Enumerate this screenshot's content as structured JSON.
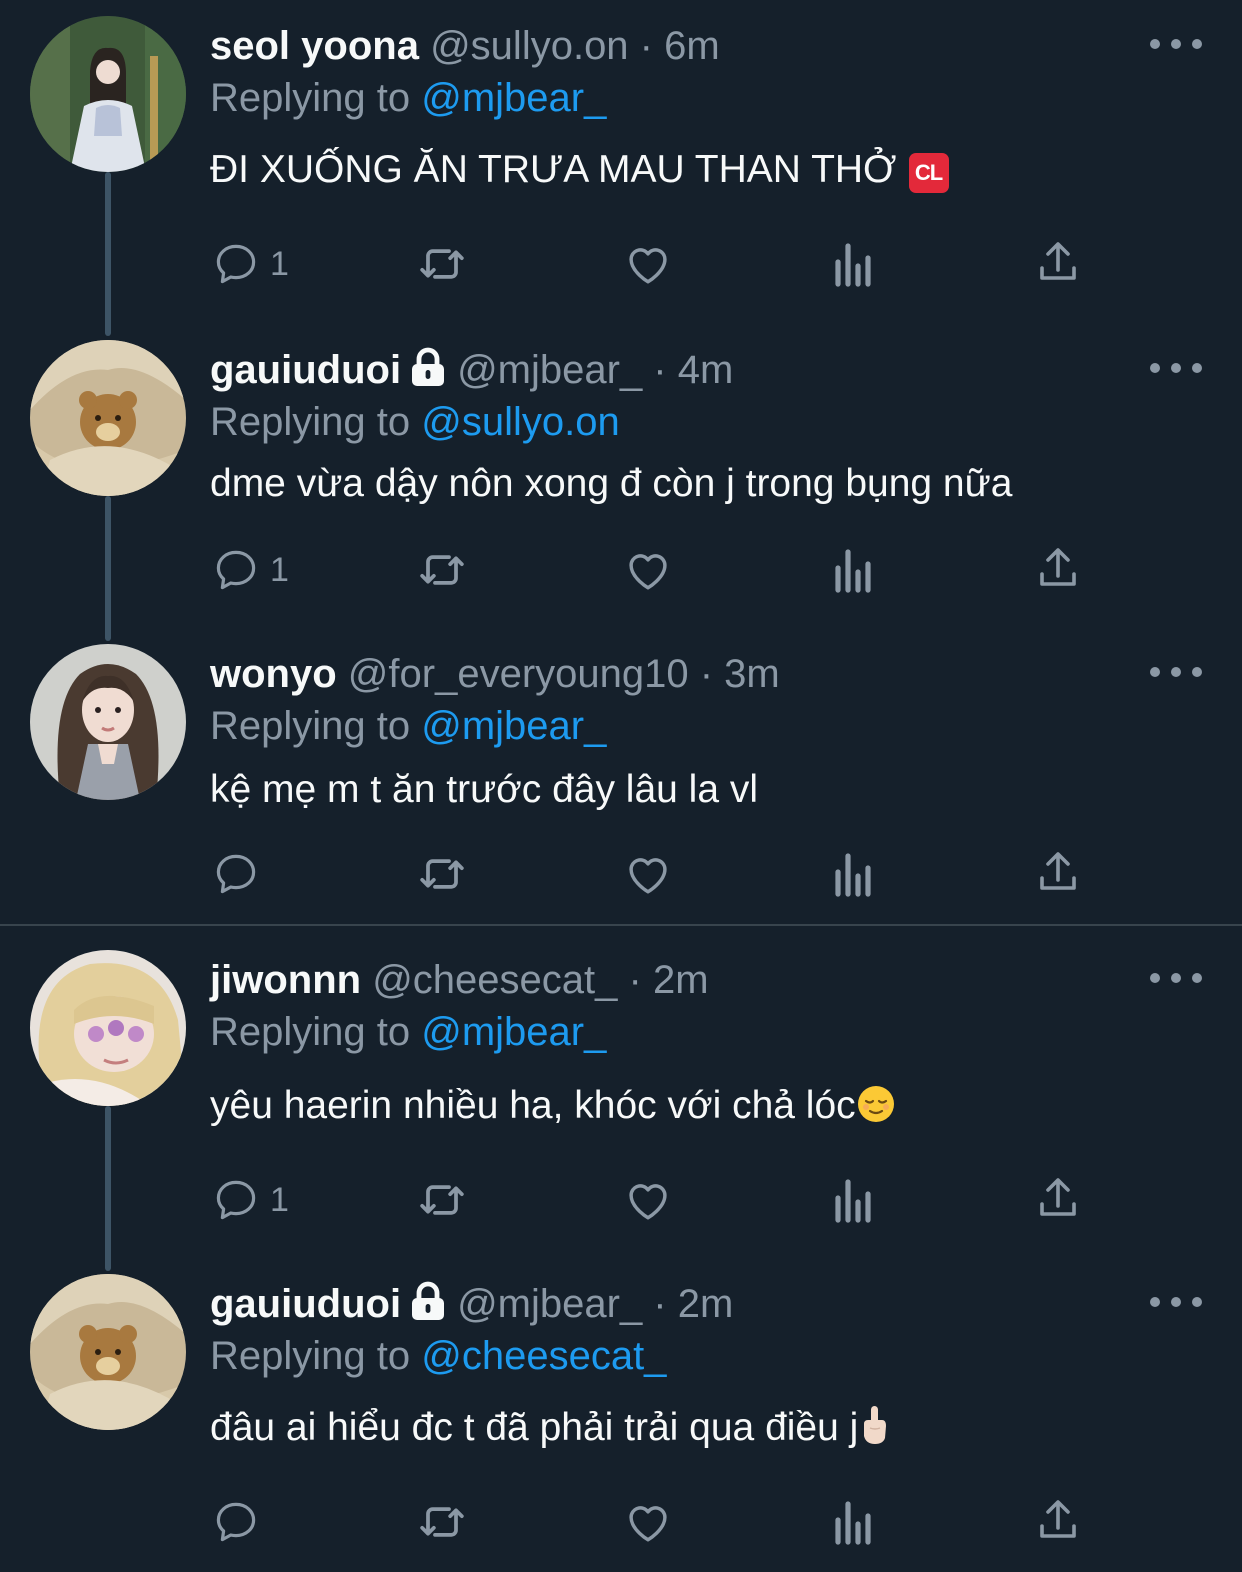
{
  "tweets": [
    {
      "name": "seol yoona",
      "handle_meta": "@sullyo.on · 6m",
      "replying_prefix": "Replying to ",
      "replying_to": "@mjbear_",
      "text": "ĐI XUỐNG ĂN TRƯA MAU THAN THỞ",
      "emoji": "CL",
      "reply_count": "1",
      "locked": false,
      "avatar": "girl-with-crown-photo"
    },
    {
      "name": "gauiuduoi",
      "handle_meta": "@mjbear_ · 4m",
      "replying_prefix": "Replying to ",
      "replying_to": "@sullyo.on",
      "text": "dme vừa dậy nôn xong đ còn j trong bụng nữa",
      "reply_count": "1",
      "locked": true,
      "avatar": "teddy-bear-blanket-photo"
    },
    {
      "name": "wonyo",
      "handle_meta": "@for_everyoung10 · 3m",
      "replying_prefix": "Replying to ",
      "replying_to": "@mjbear_",
      "text": "kệ mẹ m t ăn trước đây lâu la vl",
      "reply_count": "",
      "locked": false,
      "avatar": "girl-long-hair-photo"
    },
    {
      "name": "jiwonnn",
      "handle_meta": "@cheesecat_ · 2m",
      "replying_prefix": "Replying to ",
      "replying_to": "@mjbear_",
      "text": "yêu haerin nhiều ha, khóc với chả lóc",
      "reply_count": "1",
      "locked": false,
      "avatar": "blonde-girl-stickers-photo"
    },
    {
      "name": "gauiuduoi",
      "handle_meta": "@mjbear_ · 2m",
      "replying_prefix": "Replying to ",
      "replying_to": "@cheesecat_",
      "text": "đâu ai hiểu đc t đã phải trải qua điều j",
      "reply_count": "",
      "locked": true,
      "avatar": "teddy-bear-blanket-photo"
    }
  ],
  "icons": {
    "reply": "reply-bubble-icon",
    "retweet": "retweet-icon",
    "like": "heart-icon",
    "views": "views-chart-icon",
    "share": "share-icon",
    "more": "more-dots-icon",
    "lock": "lock-icon"
  },
  "colors": {
    "background": "#15202b",
    "primary_text": "#f7f9f9",
    "secondary_text": "#8b98a5",
    "link": "#1d9bf0",
    "thread_line": "#3d5466",
    "divider": "#38444d"
  }
}
